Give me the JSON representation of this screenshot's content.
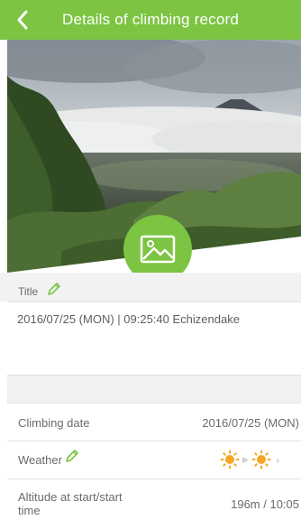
{
  "header": {
    "title": "Details of climbing record",
    "back_icon": "chevron-left-icon"
  },
  "photo": {
    "description_icon": "photo-placeholder-icon"
  },
  "title_section": {
    "label": "Title",
    "edit_icon": "pencil-icon"
  },
  "record": {
    "title_text": "2016/07/25 (MON) | 09:25:40 Echizendake"
  },
  "details": {
    "climbing_date_label": "Climbing date",
    "climbing_date_value": "2016/07/25 (MON)",
    "weather_label": "Weather",
    "weather_start_icon": "sun-icon",
    "weather_end_icon": "sun-icon",
    "altitude_label_line1": "Altitude at start/start",
    "altitude_label_line2": "time",
    "altitude_value": "196m / 10:05"
  },
  "colors": {
    "accent": "#7cc442",
    "sun": "#f5a623"
  }
}
